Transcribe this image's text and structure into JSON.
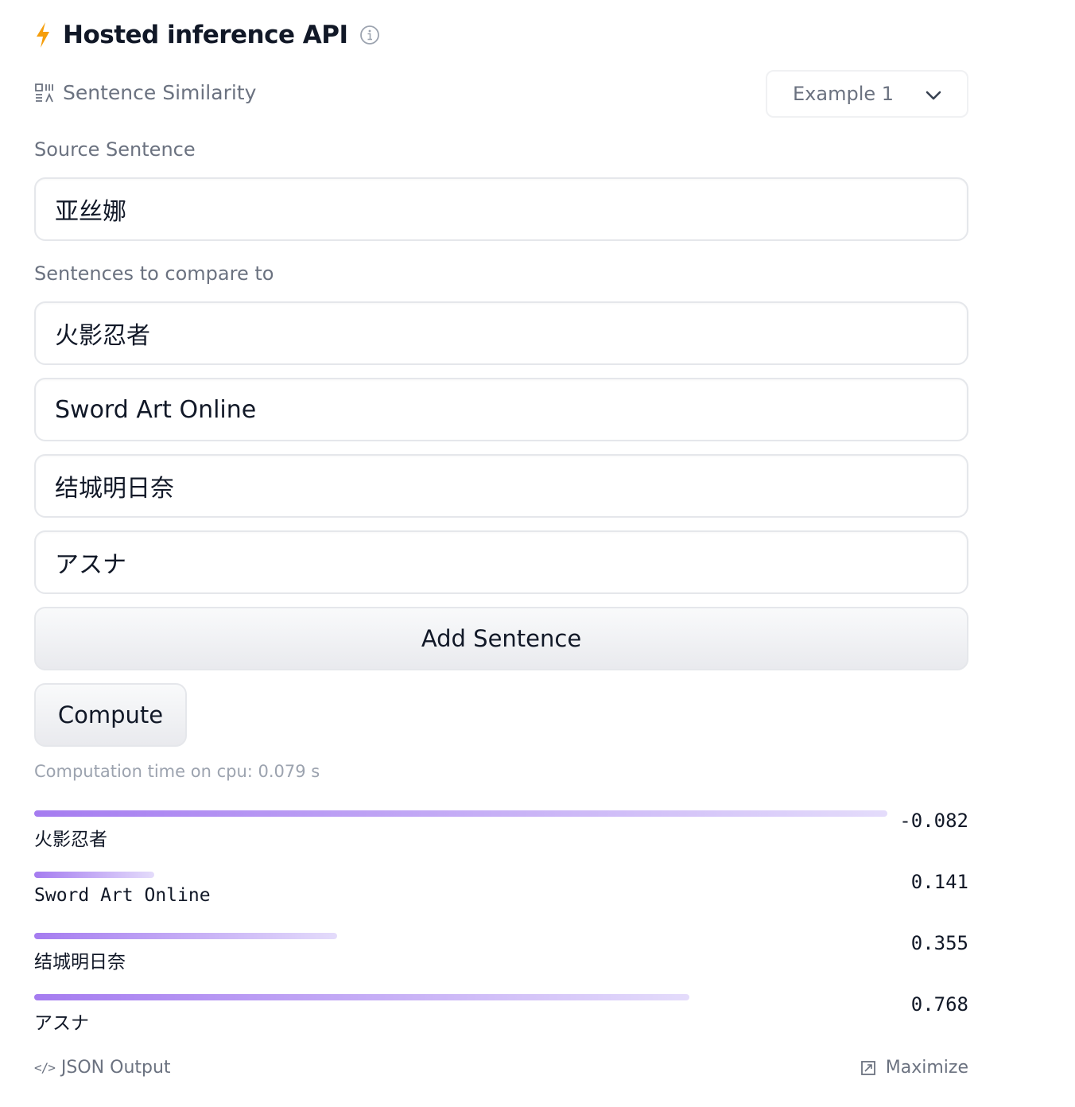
{
  "header": {
    "title": "Hosted inference API",
    "accent_color": "#f59e0b"
  },
  "task": {
    "label": "Sentence Similarity",
    "example_select": "Example 1"
  },
  "source": {
    "label": "Source Sentence",
    "value": "亚丝娜"
  },
  "compare": {
    "label": "Sentences to compare to",
    "sentences": [
      "火影忍者",
      "Sword Art Online",
      "结城明日奈",
      "アスナ"
    ]
  },
  "buttons": {
    "add_label": "Add Sentence",
    "compute_label": "Compute"
  },
  "timing": "Computation time on cpu: 0.079 s",
  "results": [
    {
      "label": "火影忍者",
      "score": "-0.082",
      "value": -0.082
    },
    {
      "label": "Sword Art Online",
      "score": "0.141",
      "value": 0.141
    },
    {
      "label": "结城明日奈",
      "score": "0.355",
      "value": 0.355
    },
    {
      "label": "アスナ",
      "score": "0.768",
      "value": 0.768
    }
  ],
  "footer": {
    "json_output": "JSON Output",
    "maximize": "Maximize"
  }
}
